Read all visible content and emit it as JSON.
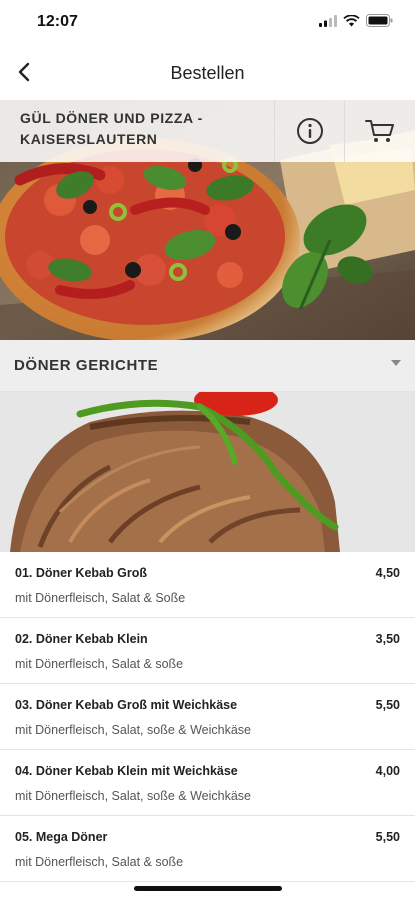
{
  "status_bar": {
    "time": "12:07"
  },
  "nav": {
    "title": "Bestellen"
  },
  "header": {
    "restaurant_line1": "GÜL DÖNER UND PIZZA -",
    "restaurant_line2": "KAISERSLAUTERN"
  },
  "category": {
    "title": "DÖNER GERICHTE"
  },
  "menu_items": [
    {
      "name": "01. Döner Kebab Groß",
      "price": "4,50",
      "description": "mit Dönerfleisch, Salat & Soße"
    },
    {
      "name": "02. Döner Kebab Klein",
      "price": "3,50",
      "description": "mit Dönerfleisch, Salat & soße"
    },
    {
      "name": "03. Döner Kebab Groß mit Weichkäse",
      "price": "5,50",
      "description": "mit Dönerfleisch, Salat, soße & Weichkäse"
    },
    {
      "name": "04. Döner Kebab Klein mit Weichkäse",
      "price": "4,00",
      "description": "mit Dönerfleisch, Salat, soße & Weichkäse"
    },
    {
      "name": "05. Mega Döner",
      "price": "5,50",
      "description": "mit Dönerfleisch, Salat & soße"
    }
  ],
  "icons": {
    "back": "chevron-left-icon",
    "info": "info-icon",
    "cart": "cart-icon",
    "caret": "caret-down-icon"
  }
}
